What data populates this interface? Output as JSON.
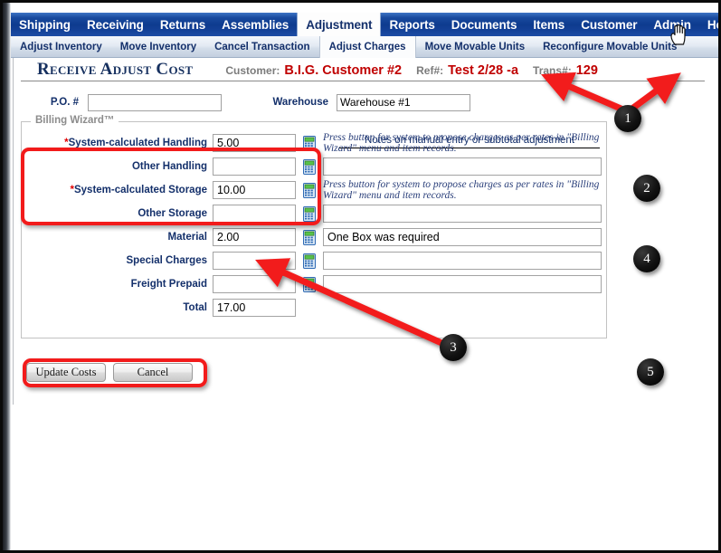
{
  "nav": {
    "items": [
      {
        "label": "Shipping",
        "active": false
      },
      {
        "label": "Receiving",
        "active": false
      },
      {
        "label": "Returns",
        "active": false
      },
      {
        "label": "Assemblies",
        "active": false
      },
      {
        "label": "Adjustment",
        "active": true
      },
      {
        "label": "Reports",
        "active": false
      },
      {
        "label": "Documents",
        "active": false
      },
      {
        "label": "Items",
        "active": false
      },
      {
        "label": "Customer",
        "active": false
      },
      {
        "label": "Admin",
        "active": false
      },
      {
        "label": "Home",
        "active": false
      }
    ]
  },
  "subnav": {
    "items": [
      {
        "label": "Adjust Inventory",
        "active": false
      },
      {
        "label": "Move Inventory",
        "active": false
      },
      {
        "label": "Cancel Transaction",
        "active": false
      },
      {
        "label": "Adjust Charges",
        "active": true
      },
      {
        "label": "Move Movable Units",
        "active": false
      },
      {
        "label": "Reconfigure Movable Units",
        "active": false
      }
    ]
  },
  "header": {
    "page_title": "Receive Adjust Cost",
    "customer_label": "Customer:",
    "customer_value": "B.I.G. Customer #2",
    "ref_label": "Ref#:",
    "ref_value": "Test 2/28 -a",
    "trans_label": "Trans#:",
    "trans_value": "129"
  },
  "form": {
    "po_label": "P.O. #",
    "po_value": "",
    "warehouse_label": "Warehouse",
    "warehouse_value": "Warehouse #1",
    "fieldset_legend": "Billing Wizard™",
    "notes_header": "Notes on manual entry or subtotal adjustment",
    "hint_text": "Press button for system to propose charges as per rates in \"Billing Wizard\" menu and item records.",
    "rows": [
      {
        "label": "System-calculated Handling",
        "required": true,
        "amount": "5.00",
        "has_calc": true,
        "note_kind": "hint",
        "note": ""
      },
      {
        "label": "Other Handling",
        "required": false,
        "amount": "",
        "has_calc": true,
        "note_kind": "input",
        "note": ""
      },
      {
        "label": "System-calculated Storage",
        "required": true,
        "amount": "10.00",
        "has_calc": true,
        "note_kind": "hint",
        "note": ""
      },
      {
        "label": "Other Storage",
        "required": false,
        "amount": "",
        "has_calc": true,
        "note_kind": "input",
        "note": ""
      },
      {
        "label": "Material",
        "required": false,
        "amount": "2.00",
        "has_calc": true,
        "note_kind": "input",
        "note": "One Box was required"
      },
      {
        "label": "Special Charges",
        "required": false,
        "amount": "",
        "has_calc": true,
        "note_kind": "input",
        "note": ""
      },
      {
        "label": "Freight Prepaid",
        "required": false,
        "amount": "",
        "has_calc": true,
        "note_kind": "input",
        "note": ""
      },
      {
        "label": "Total",
        "required": false,
        "amount": "17.00",
        "has_calc": false,
        "note_kind": "none",
        "note": ""
      }
    ]
  },
  "buttons": {
    "update_label": "Update Costs",
    "cancel_label": "Cancel"
  },
  "annotations": {
    "callouts": [
      {
        "number": "1"
      },
      {
        "number": "2"
      },
      {
        "number": "3"
      },
      {
        "number": "4"
      },
      {
        "number": "5"
      }
    ],
    "accent_color": "#f21b1b"
  }
}
